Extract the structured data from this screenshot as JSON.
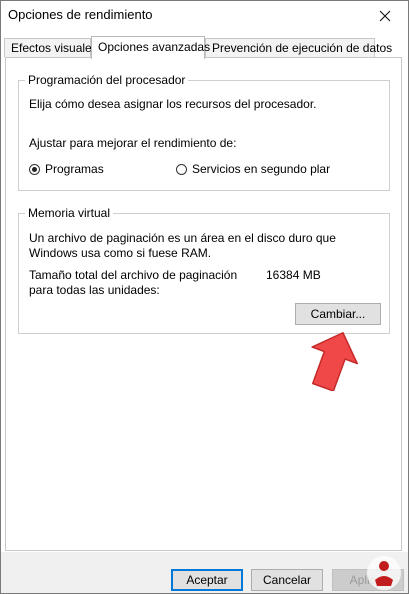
{
  "window": {
    "title": "Opciones de rendimiento"
  },
  "tabs": [
    {
      "label": "Efectos visuales"
    },
    {
      "label": "Opciones avanzadas"
    },
    {
      "label": "Prevención de ejecución de datos"
    }
  ],
  "processor": {
    "group_title": "Programación del procesador",
    "description": "Elija cómo desea asignar los recursos del procesador.",
    "adjust_label": "Ajustar para mejorar el rendimiento de:",
    "option_programs": "Programas",
    "option_services": "Servicios en segundo plar",
    "selected": "Programas"
  },
  "virtual_memory": {
    "group_title": "Memoria virtual",
    "description_line1": "Un archivo de paginación es un área en el disco duro que",
    "description_line2": "Windows usa como si fuese RAM.",
    "total_label_line1": "Tamaño total del archivo de paginación",
    "total_label_line2": "para todas las unidades:",
    "total_value": "16384 MB",
    "change_button": "Cambiar..."
  },
  "footer": {
    "accept": "Aceptar",
    "cancel": "Cancelar",
    "apply": "Aplicar"
  },
  "colors": {
    "arrow_fill": "#f04848",
    "primary_border": "#0078d7"
  }
}
